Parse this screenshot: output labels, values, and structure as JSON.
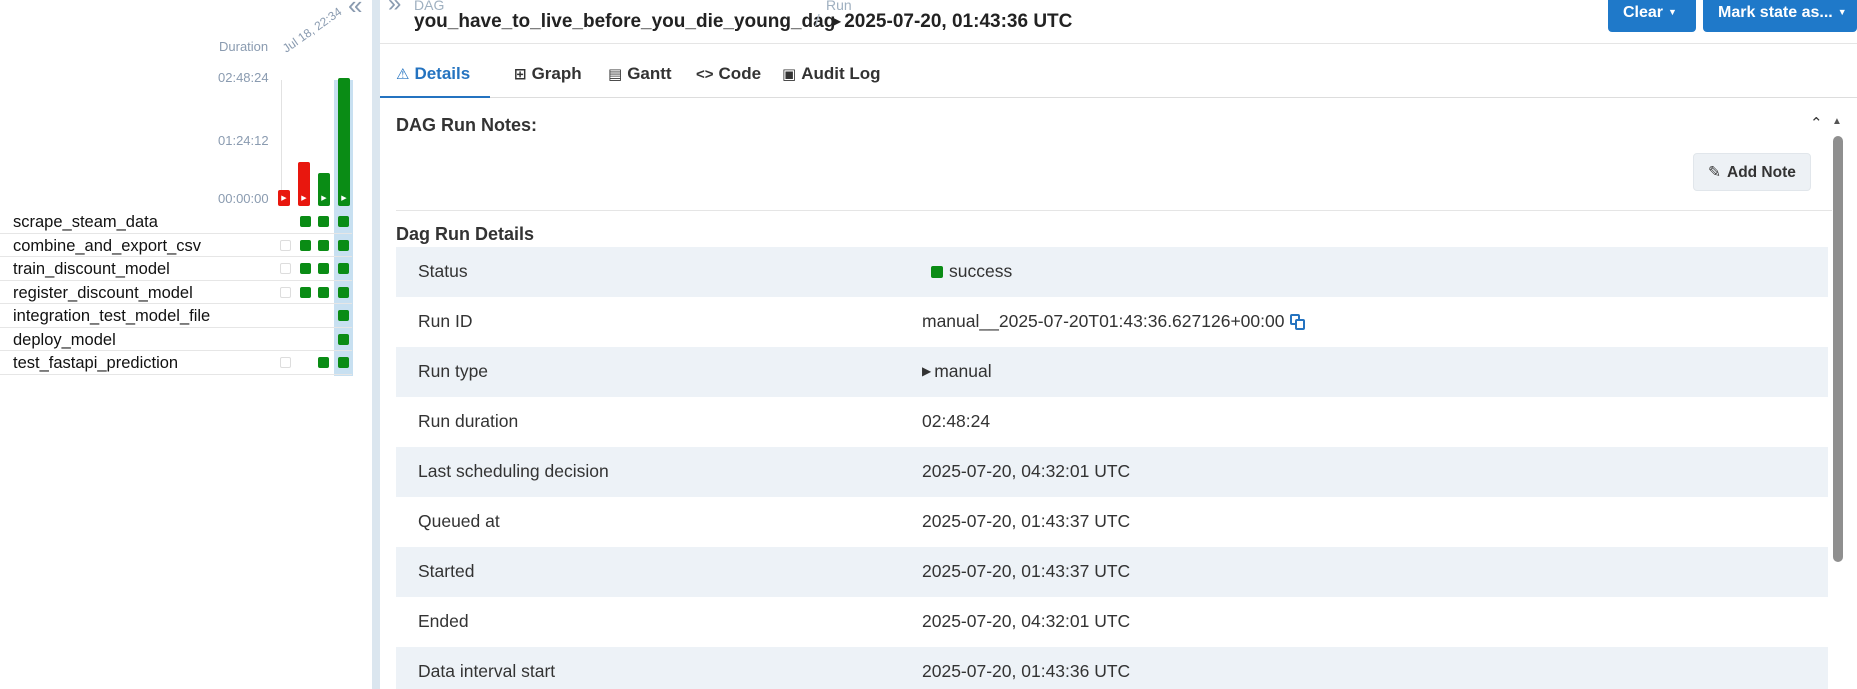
{
  "grid": {
    "collapse_glyph": "«",
    "duration_label": "Duration",
    "run_date_label": "Jul 18, 22:34",
    "ticks": [
      "02:48:24",
      "01:24:12",
      "00:00:00"
    ],
    "runs": [
      {
        "state": "failed",
        "color": "#e8170e",
        "duration_fraction": 0.09
      },
      {
        "state": "failed",
        "color": "#e8170e",
        "duration_fraction": 0.34
      },
      {
        "state": "success",
        "color": "#0a8c15",
        "duration_fraction": 0.26
      },
      {
        "state": "success",
        "color": "#0a8c15",
        "duration_fraction": 1.0
      }
    ],
    "tasks": [
      {
        "name": "scrape_steam_data",
        "cells": [
          "",
          "success",
          "success",
          "success"
        ]
      },
      {
        "name": "combine_and_export_csv",
        "cells": [
          "none",
          "success",
          "success",
          "success"
        ]
      },
      {
        "name": "train_discount_model",
        "cells": [
          "none",
          "success",
          "success",
          "success"
        ]
      },
      {
        "name": "register_discount_model",
        "cells": [
          "none",
          "success",
          "success",
          "success"
        ]
      },
      {
        "name": "integration_test_model_file",
        "cells": [
          "",
          "",
          "",
          "success"
        ]
      },
      {
        "name": "deploy_model",
        "cells": [
          "",
          "",
          "",
          "success"
        ]
      },
      {
        "name": "test_fastapi_prediction",
        "cells": [
          "none",
          "",
          "success",
          "success"
        ]
      }
    ]
  },
  "header": {
    "expand_glyph": "»",
    "dag_label": "DAG",
    "dag_id": "you_have_to_live_before_you_die_young_dag",
    "separator": "/",
    "run_label": "Run",
    "run_id": "2025-07-20, 01:43:36 UTC",
    "clear_label": "Clear",
    "mark_state_label": "Mark state as..."
  },
  "tabs": [
    {
      "label": "Details",
      "icon": "warning-triangle-icon",
      "active": true
    },
    {
      "label": "Graph",
      "icon": "graph-icon",
      "active": false
    },
    {
      "label": "Gantt",
      "icon": "gantt-icon",
      "active": false
    },
    {
      "label": "Code",
      "icon": "code-icon",
      "active": false
    },
    {
      "label": "Audit Log",
      "icon": "audit-log-icon",
      "active": false
    }
  ],
  "notes": {
    "title": "DAG Run Notes:",
    "add_note_label": "Add Note"
  },
  "details": {
    "title": "Dag Run Details",
    "rows": [
      {
        "key": "Status",
        "value": "success"
      },
      {
        "key": "Run ID",
        "value": "manual__2025-07-20T01:43:36.627126+00:00"
      },
      {
        "key": "Run type",
        "value": "manual"
      },
      {
        "key": "Run duration",
        "value": "02:48:24"
      },
      {
        "key": "Last scheduling decision",
        "value": "2025-07-20, 04:32:01 UTC"
      },
      {
        "key": "Queued at",
        "value": "2025-07-20, 01:43:37 UTC"
      },
      {
        "key": "Started",
        "value": "2025-07-20, 01:43:37 UTC"
      },
      {
        "key": "Ended",
        "value": "2025-07-20, 04:32:01 UTC"
      },
      {
        "key": "Data interval start",
        "value": "2025-07-20, 01:43:36 UTC"
      }
    ]
  },
  "colors": {
    "accent": "#1f79c9",
    "success": "#0a8c15",
    "failed": "#e8170e",
    "row_shade": "#edf2f7"
  }
}
